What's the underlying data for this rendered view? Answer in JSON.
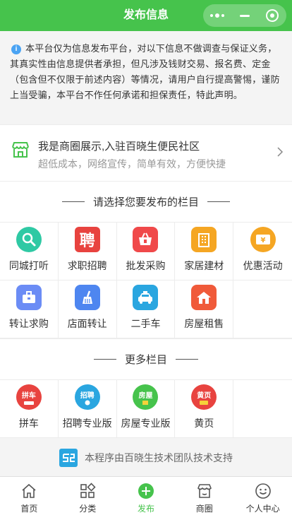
{
  "topbar": {
    "title": "发布信息"
  },
  "notice": {
    "text": "本平台仅为信息发布平台，对以下信息不做调查与保证义务，其真实性由信息提供者承担，但凡涉及钱财交易、报名费、定金（包含但不仅限于前述内容）等情况，请用户自行提高警惕，谨防上当受骗，本平台不作任何承诺和担保责任，特此声明。"
  },
  "merchant": {
    "title": "我是商圈展示,入驻百晓生便民社区",
    "subtitle": "超低成本，网络宣传，简单有效，方便快捷"
  },
  "section1": {
    "heading": "请选择您要发布的栏目",
    "items": [
      {
        "label": "同城打听",
        "icon": "search-icon",
        "color": "#2fc9a4"
      },
      {
        "label": "求职招聘",
        "icon": "recruit-icon",
        "color": "#e8433f"
      },
      {
        "label": "批发采购",
        "icon": "basket-icon",
        "color": "#f0494a"
      },
      {
        "label": "家居建材",
        "icon": "building-icon",
        "color": "#f5a623"
      },
      {
        "label": "优惠活动",
        "icon": "coupon-icon",
        "color": "#f5a623"
      },
      {
        "label": "转让求购",
        "icon": "briefcase-icon",
        "color": "#6b8cf5"
      },
      {
        "label": "店面转让",
        "icon": "broom-icon",
        "color": "#4e86f0"
      },
      {
        "label": "二手车",
        "icon": "taxi-icon",
        "color": "#2aa6e0"
      },
      {
        "label": "房屋租售",
        "icon": "house-icon",
        "color": "#f05a3a"
      }
    ]
  },
  "section2": {
    "heading": "更多栏目",
    "items": [
      {
        "label": "拼车",
        "badge": "拼车",
        "icon": "carpool-icon",
        "color": "#e8433f"
      },
      {
        "label": "招聘专业版",
        "badge": "招聘",
        "icon": "recruit-pro-icon",
        "color": "#2aa6e0"
      },
      {
        "label": "房屋专业版",
        "badge": "房屋",
        "icon": "house-pro-icon",
        "color": "#46c34c"
      },
      {
        "label": "黄页",
        "badge": "黄页",
        "icon": "yellow-pages-icon",
        "color": "#e8433f"
      }
    ]
  },
  "footer": {
    "text": "本程序由百晓生技术团队技术支持"
  },
  "tabbar": {
    "items": [
      {
        "label": "首页",
        "icon": "home-icon"
      },
      {
        "label": "分类",
        "icon": "category-icon"
      },
      {
        "label": "发布",
        "icon": "publish-icon",
        "active": true
      },
      {
        "label": "商圈",
        "icon": "shop-icon"
      },
      {
        "label": "个人中心",
        "icon": "profile-icon"
      }
    ]
  }
}
